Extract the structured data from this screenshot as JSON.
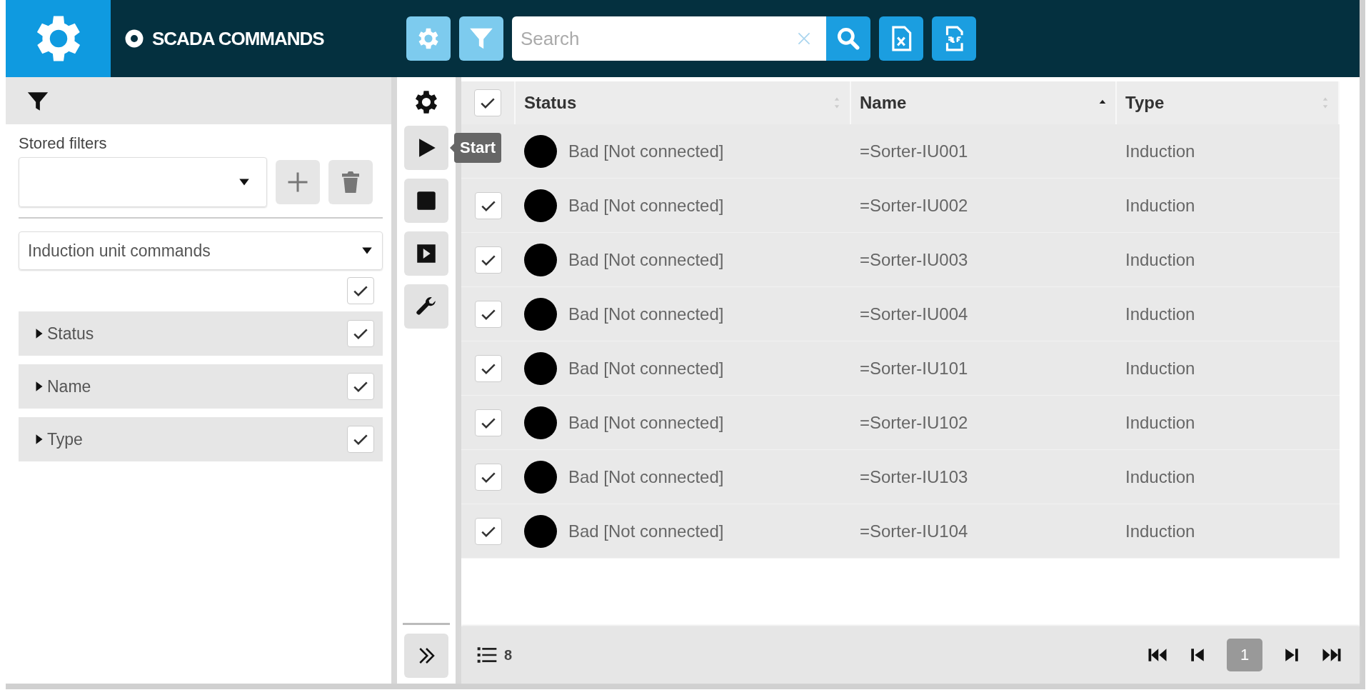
{
  "header": {
    "title": "SCADA COMMANDS",
    "search": {
      "placeholder": "Search"
    }
  },
  "filter_panel": {
    "stored_filters_label": "Stored filters",
    "command_set": "Induction unit commands",
    "all_fields_checked": true,
    "fields": [
      {
        "label": "Status",
        "expanded": false,
        "checked": true
      },
      {
        "label": "Name",
        "expanded": false,
        "checked": true
      },
      {
        "label": "Type",
        "expanded": false,
        "checked": true
      }
    ]
  },
  "commands": [
    {
      "kind": "start",
      "tooltip": "Start"
    },
    {
      "kind": "stop"
    },
    {
      "kind": "step"
    },
    {
      "kind": "tools"
    }
  ],
  "table": {
    "all_checked": true,
    "columns": [
      {
        "label": "Status",
        "sorted": false
      },
      {
        "label": "Name",
        "sorted": true,
        "descending": false
      },
      {
        "label": "Type",
        "sorted": false
      }
    ],
    "rows": [
      {
        "color": "#000000",
        "status": "Bad [Not connected]",
        "name": "=Sorter-IU001",
        "type": "Induction"
      },
      {
        "checked": true,
        "color": "#000000",
        "status": "Bad [Not connected]",
        "name": "=Sorter-IU002",
        "type": "Induction"
      },
      {
        "checked": true,
        "color": "#000000",
        "status": "Bad [Not connected]",
        "name": "=Sorter-IU003",
        "type": "Induction"
      },
      {
        "checked": true,
        "color": "#000000",
        "status": "Bad [Not connected]",
        "name": "=Sorter-IU004",
        "type": "Induction"
      },
      {
        "checked": true,
        "color": "#000000",
        "status": "Bad [Not connected]",
        "name": "=Sorter-IU101",
        "type": "Induction"
      },
      {
        "checked": true,
        "color": "#000000",
        "status": "Bad [Not connected]",
        "name": "=Sorter-IU102",
        "type": "Induction"
      },
      {
        "checked": true,
        "color": "#000000",
        "status": "Bad [Not connected]",
        "name": "=Sorter-IU103",
        "type": "Induction"
      },
      {
        "checked": true,
        "color": "#000000",
        "status": "Bad [Not connected]",
        "name": "=Sorter-IU104",
        "type": "Induction"
      }
    ]
  },
  "footer": {
    "count": "8",
    "pages": [
      {
        "label": "1",
        "selected": true
      }
    ]
  }
}
